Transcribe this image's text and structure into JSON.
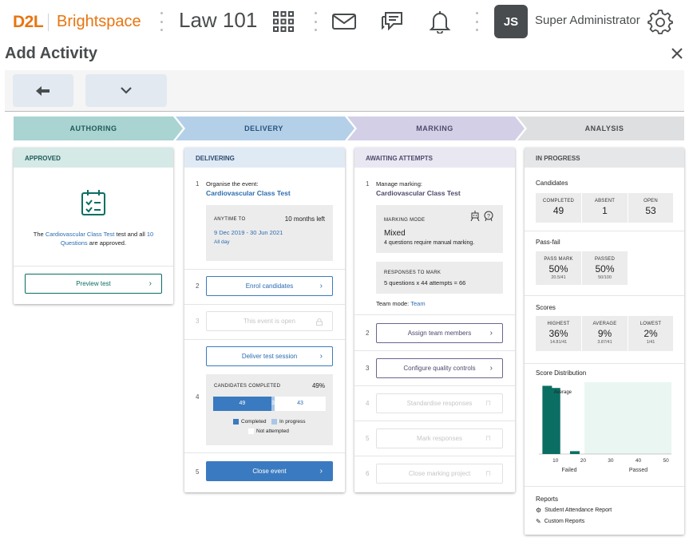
{
  "header": {
    "logo_mark": "D2L",
    "logo_text": "Brightspace",
    "course": "Law 101",
    "user_initials": "JS",
    "user_name": "Super Administrator"
  },
  "page": {
    "title": "Add Activity"
  },
  "stages": [
    {
      "label": "AUTHORING",
      "color": "#a9d4d2"
    },
    {
      "label": "DELIVERY",
      "color": "#b4d0e8"
    },
    {
      "label": "MARKING",
      "color": "#d3cfe6"
    },
    {
      "label": "ANALYSIS",
      "color": "#dedfe0"
    }
  ],
  "authoring": {
    "status": "APPROVED",
    "text_pre": "The",
    "test_link": "Cardiovascular Class Test",
    "text_mid": "test and all",
    "questions_link": "10 Questions",
    "text_post": "are approved.",
    "preview_button": "Preview test"
  },
  "delivery": {
    "status": "DELIVERING",
    "step1_num": "1",
    "step1_label": "Organise the event:",
    "step1_link": "Cardiovascular Class Test",
    "anytime_label": "ANYTIME TO",
    "time_left": "10 months left",
    "date_range": "9 Dec 2019 - 30 Jun 2021",
    "all_day": "All day",
    "step2_num": "2",
    "enrol_button": "Enrol candidates",
    "step3_num": "3",
    "open_button": "This event is open",
    "step4_num": "4",
    "deliver_button": "Deliver test session",
    "completed_label": "CANDIDATES COMPLETED",
    "completed_pct": "49%",
    "progress": {
      "completed": 49,
      "in_progress": 3,
      "not_attempted": 43,
      "total": 95
    },
    "legend_completed": "Completed",
    "legend_in_progress": "In progress",
    "legend_not_attempted": "Not attempted",
    "step5_num": "5",
    "close_button": "Close event"
  },
  "marking": {
    "status": "AWAITING ATTEMPTS",
    "step1_num": "1",
    "step1_label": "Manage marking:",
    "step1_link": "Cardiovascular Class Test",
    "mode_label": "MARKING MODE",
    "mode_value": "Mixed",
    "mode_note": "4 questions require manual marking.",
    "responses_label": "RESPONSES TO MARK",
    "responses_value": "5 questions x 44 attempts = 66",
    "team_mode_label": "Team mode:",
    "team_mode_value": "Team",
    "step2_num": "2",
    "assign_button": "Assign team members",
    "step3_num": "3",
    "quality_button": "Configure quality controls",
    "step4_num": "4",
    "standardise_button": "Standardise responses",
    "step5_num": "5",
    "mark_button": "Mark responses",
    "step6_num": "6",
    "close_project_button": "Close marking project"
  },
  "analysis": {
    "status": "IN PROGRESS",
    "candidates_title": "Candidates",
    "candidates": [
      {
        "label": "COMPLETED",
        "value": "49"
      },
      {
        "label": "ABSENT",
        "value": "1"
      },
      {
        "label": "OPEN",
        "value": "53"
      }
    ],
    "passfail_title": "Pass-fail",
    "passfail": [
      {
        "label": "PASS MARK",
        "value": "50%",
        "sub": "20.5/41"
      },
      {
        "label": "PASSED",
        "value": "50%",
        "sub": "50/100"
      }
    ],
    "scores_title": "Scores",
    "scores": [
      {
        "label": "HIGHEST",
        "value": "36%",
        "sub": "14.81/41"
      },
      {
        "label": "AVERAGE",
        "value": "9%",
        "sub": "3.87/41"
      },
      {
        "label": "LOWEST",
        "value": "2%",
        "sub": "1/41"
      }
    ],
    "distribution_title": "Score Distribution",
    "average_label": "Average",
    "failed_label": "Failed",
    "passed_label": "Passed",
    "reports_title": "Reports",
    "report1": "Student Attendance Report",
    "report2": "Custom Reports"
  },
  "chart_data": {
    "type": "bar",
    "title": "Score Distribution",
    "x_ticks": [
      "10",
      "20",
      "30",
      "40",
      "50"
    ],
    "bars": [
      {
        "x": 7,
        "value": 95
      },
      {
        "x": 10,
        "value": 92
      },
      {
        "x": 17,
        "value": 4
      }
    ],
    "xlim": [
      4,
      52
    ],
    "ylim": [
      0,
      100
    ],
    "groups": [
      "Failed",
      "Passed"
    ],
    "pass_mark": 20.5,
    "annotation": "Average"
  }
}
